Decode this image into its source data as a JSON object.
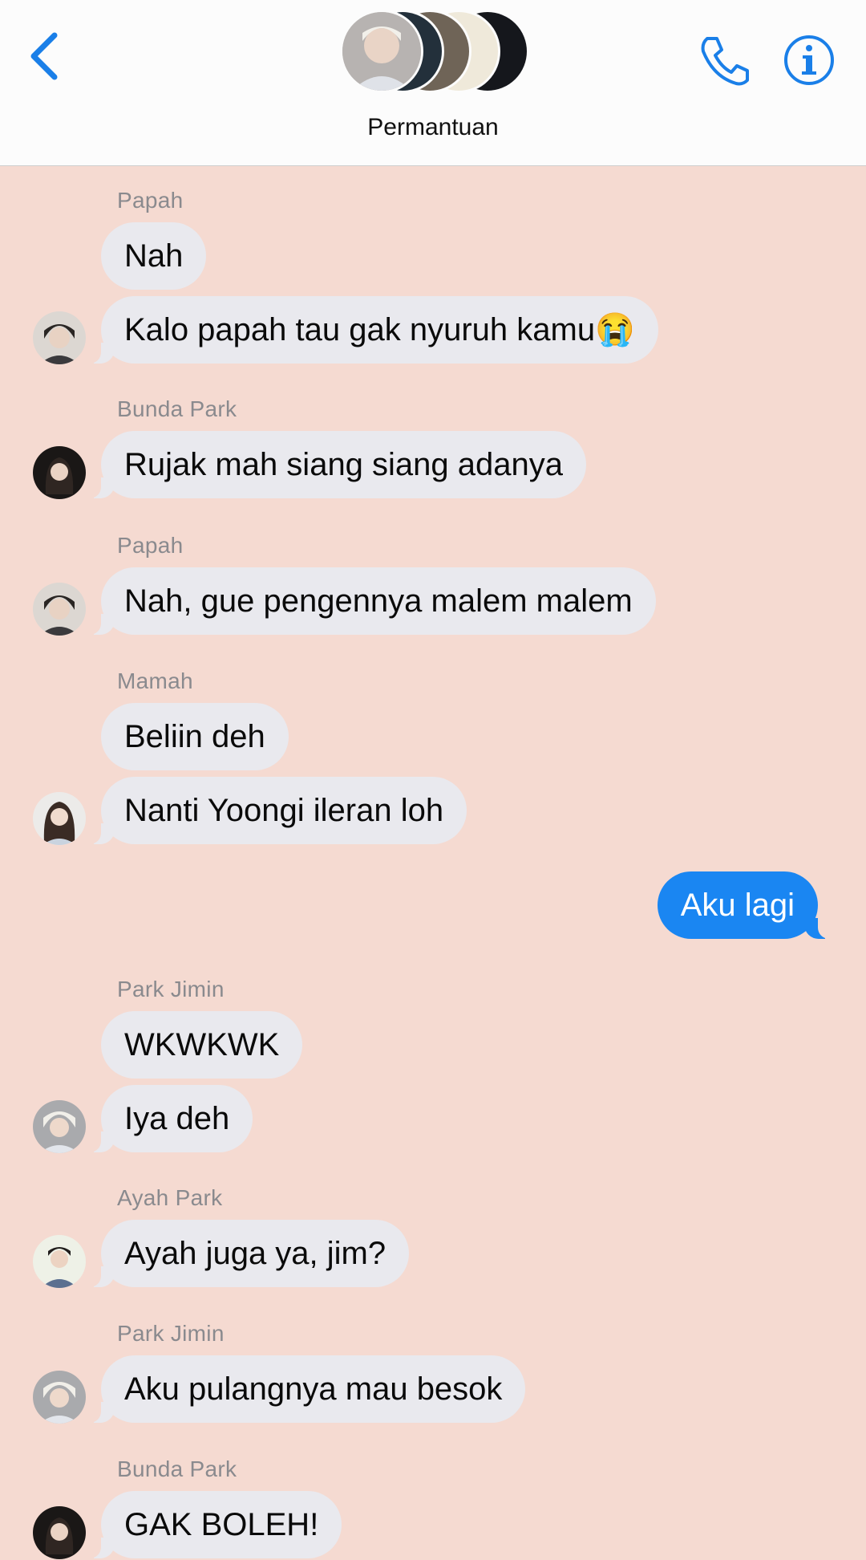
{
  "header": {
    "title": "Permantuan",
    "back_icon": "chevron-left-icon",
    "call_icon": "phone-icon",
    "info_icon": "info-icon",
    "accent_color": "#1a7fe8"
  },
  "conversation": {
    "messages": [
      {
        "sender": "Papah",
        "text": "Nah"
      },
      {
        "sender": "",
        "text": "Kalo papah tau gak nyuruh kamu😭"
      },
      {
        "sender": "Bunda Park",
        "text": "Rujak mah siang siang adanya"
      },
      {
        "sender": "Papah",
        "text": "Nah, gue pengennya malem malem"
      },
      {
        "sender": "Mamah",
        "text": "Beliin deh"
      },
      {
        "sender": "",
        "text": "Nanti Yoongi ileran loh"
      },
      {
        "sender": "",
        "text": "Aku lagi"
      },
      {
        "sender": "Park Jimin",
        "text": "WKWKWK"
      },
      {
        "sender": "",
        "text": "Iya deh"
      },
      {
        "sender": "Ayah Park",
        "text": "Ayah juga ya, jim?"
      },
      {
        "sender": "Park Jimin",
        "text": "Aku pulangnya mau besok"
      },
      {
        "sender": "Bunda Park",
        "text": "GAK BOLEH!"
      }
    ]
  },
  "colors": {
    "background": "#f5dad1",
    "incoming_bubble": "#e9e9ee",
    "outgoing_bubble": "#1a86f2",
    "sender_name": "#8a8a8e"
  }
}
